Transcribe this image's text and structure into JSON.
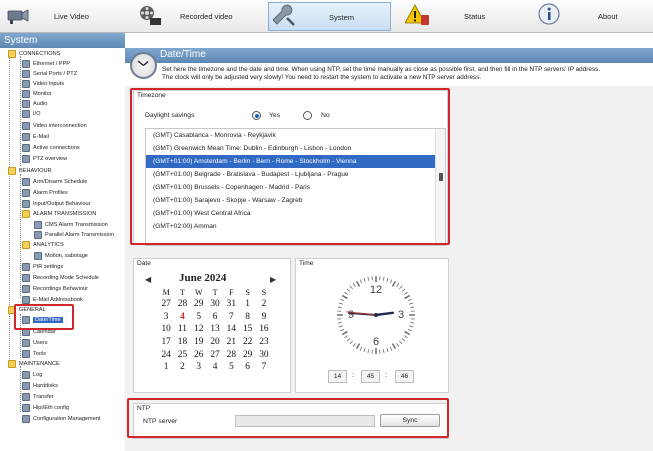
{
  "tabs": [
    {
      "label": "Live Video",
      "icon": "camera-icon"
    },
    {
      "label": "Recorded video",
      "icon": "film-reel-icon"
    },
    {
      "label": "System",
      "icon": "wrench-icon",
      "active": true
    },
    {
      "label": "Status",
      "icon": "warning-icon"
    },
    {
      "label": "About",
      "icon": "info-icon"
    }
  ],
  "sidebar": {
    "header": "System",
    "items": [
      {
        "label": "CONNECTIONS",
        "type": "folder"
      },
      {
        "label": "Ethernet / PPP",
        "type": "leaf"
      },
      {
        "label": "Serial Ports / PTZ",
        "type": "leaf"
      },
      {
        "label": "Video Inputs",
        "type": "leaf"
      },
      {
        "label": "Monitor",
        "type": "leaf"
      },
      {
        "label": "Audio",
        "type": "leaf"
      },
      {
        "label": "I/O",
        "type": "leaf"
      },
      {
        "label": "Video interconnection",
        "type": "leaf"
      },
      {
        "label": "E-Mail",
        "type": "leaf"
      },
      {
        "label": "Active connections",
        "type": "leaf"
      },
      {
        "label": "PTZ overview",
        "type": "leaf"
      },
      {
        "label": "BEHAVIOUR",
        "type": "folder"
      },
      {
        "label": "Arm/Disarm Schedule",
        "type": "leaf"
      },
      {
        "label": "Alarm Profiles",
        "type": "leaf"
      },
      {
        "label": "Input/Output Behaviour",
        "type": "leaf"
      },
      {
        "label": "ALARM TRANSMISSION",
        "type": "folder"
      },
      {
        "label": "CMS Alarm Transmission",
        "type": "leaf"
      },
      {
        "label": "Parallel Alarm Transmission",
        "type": "leaf"
      },
      {
        "label": "ANALYTICS",
        "type": "folder"
      },
      {
        "label": "Motion, sabotage",
        "type": "leaf"
      },
      {
        "label": "PIR settings",
        "type": "leaf"
      },
      {
        "label": "Recording Mode Schedule",
        "type": "leaf"
      },
      {
        "label": "Recordings Behaviour",
        "type": "leaf"
      },
      {
        "label": "E-Mail Addressbook",
        "type": "leaf"
      },
      {
        "label": "GENERAL",
        "type": "folder"
      },
      {
        "label": "Date/Time",
        "type": "leaf",
        "selected": true
      },
      {
        "label": "Calendar",
        "type": "leaf"
      },
      {
        "label": "Users",
        "type": "leaf"
      },
      {
        "label": "Tools",
        "type": "leaf"
      },
      {
        "label": "MAINTENANCE",
        "type": "folder"
      },
      {
        "label": "Log",
        "type": "leaf"
      },
      {
        "label": "Harddisks",
        "type": "leaf"
      },
      {
        "label": "Transfer",
        "type": "leaf"
      },
      {
        "label": "Hipi/Eth config",
        "type": "leaf"
      },
      {
        "label": "Configuration Management",
        "type": "leaf"
      }
    ]
  },
  "page": {
    "title": "Date/Time",
    "description_line1": "Set here the timezone and the date and time. When using NTP, set the time manually as close as possible first, and then fill in the NTP servers' IP address.",
    "description_line2": "The clock will only be adjusted very slowly! You need to restart the system to activate a new NTP server address."
  },
  "timezone": {
    "title": "Timezone",
    "daylight_label": "Daylight savings",
    "yes_label": "Yes",
    "no_label": "No",
    "daylight_value": "Yes",
    "options": [
      "(GMT) Casablanca - Monrovia - Reykjavik",
      "(GMT) Greenwich Mean Time: Dublin - Edinburgh - Lisbon - London",
      "(GMT+01:00) Amsterdam - Berlin - Bern - Rome - Stockholm - Vienna",
      "(GMT+01:00) Belgrade - Bratislava - Budapest - Ljubljana - Prague",
      "(GMT+01:00) Brussels - Copenhagen - Madrid - Paris",
      "(GMT+01:00) Sarajevo - Skopje - Warsaw - Zagreb",
      "(GMT+01:00) West Central Africa",
      "(GMT+02:00) Amman"
    ],
    "selected_index": 2
  },
  "date": {
    "title": "Date",
    "month_year": "June 2024",
    "prev_symbol": "◀",
    "next_symbol": "▶",
    "weekdays": [
      "M",
      "T",
      "W",
      "T",
      "F",
      "S",
      "S"
    ],
    "weeks": [
      [
        "27",
        "28",
        "29",
        "30",
        "31",
        "1",
        "2"
      ],
      [
        "3",
        "4",
        "5",
        "6",
        "7",
        "8",
        "9"
      ],
      [
        "10",
        "11",
        "12",
        "13",
        "14",
        "15",
        "16"
      ],
      [
        "17",
        "18",
        "19",
        "20",
        "21",
        "22",
        "23"
      ],
      [
        "24",
        "25",
        "26",
        "27",
        "28",
        "29",
        "30"
      ],
      [
        "1",
        "2",
        "3",
        "4",
        "5",
        "6",
        "7"
      ]
    ],
    "today": "4"
  },
  "time": {
    "title": "Time",
    "hours": "14",
    "minutes": "45",
    "seconds": "46",
    "clock_numbers": [
      "12",
      "3",
      "6",
      "9"
    ],
    "separator": ":"
  },
  "ntp": {
    "title": "NTP",
    "server_label": "NTP server",
    "server_value": "",
    "sync_label": "Sync"
  },
  "colors": {
    "accent": "#316ac5",
    "highlight_frame": "#d0272d",
    "header_blue": "#5e88b4"
  }
}
